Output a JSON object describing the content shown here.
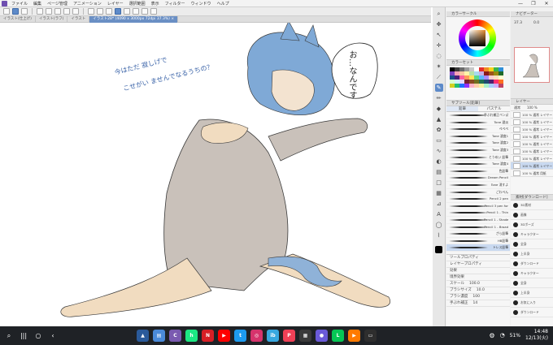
{
  "menu": {
    "items": [
      "ファイル",
      "編集",
      "ページ管理",
      "アニメーション",
      "レイヤー",
      "選択範囲",
      "表示",
      "フィルター",
      "ウィンドウ",
      "ヘルプ"
    ],
    "window_controls": [
      "—",
      "❐",
      "✕"
    ]
  },
  "tabs": [
    {
      "label": "イラスト(仕上げ) ",
      "active": false
    },
    {
      "label": "イラスト(ラフ)",
      "active": false
    },
    {
      "label": "イラスト",
      "active": false
    },
    {
      "label": "イラスト28* (4090 x 3000px 72dpi 37.3%) ×",
      "active": true
    }
  ],
  "canvas": {
    "handwritten_note_line1": "今はただ 寂しげで",
    "handwritten_note_line2": "こせがい ませんでなるうちの？",
    "speech_bubble": "お…なんです"
  },
  "color_panel": {
    "title": "カラーサークル",
    "palette_title": "カラーセット",
    "swatches": [
      "#000000",
      "#3a3a3a",
      "#6b6b6b",
      "#9a9a9a",
      "#c8c8c8",
      "#ffffff",
      "#e52e2e",
      "#f08a24",
      "#f7d21e",
      "#3bb44a",
      "#2f8fd8",
      "#7a3fbf",
      "#f4a3b5",
      "#f9c8a0",
      "#fff4a8",
      "#b6e3a8",
      "#a8d8f0",
      "#c8b0e8",
      "#8b1a1a",
      "#a0551a",
      "#9a8a10",
      "#1f6a2a",
      "#1a4f8a",
      "#4a1f7a",
      "#ff5fa0",
      "#ff9a5a",
      "#ffe55a",
      "#5ad88a",
      "#5ab8ff",
      "#a88aff",
      "#ffd0d0",
      "#ffe0c0",
      "#ffffd0",
      "#d8ffd0",
      "#d0f0ff",
      "#e8d8ff",
      "#7a2030",
      "#8a4a20",
      "#707020",
      "#207050",
      "#204a70",
      "#502070",
      "#ff3070",
      "#ff7020",
      "#d0d020",
      "#20c070",
      "#2070ff",
      "#9030ff",
      "#ffb0c8",
      "#ffd0a8",
      "#f8f0a0",
      "#a8f0c8",
      "#a8d0ff",
      "#d0b0ff",
      "#c04060"
    ]
  },
  "brush_panel": {
    "title": "サブツール[鉛筆]",
    "tab_left": "鉛筆",
    "tab_right": "パステル",
    "brushes": [
      "手ぶれ補正ペン(改)",
      "Tone 濃淡",
      "ぺぺぺ",
      "Tone 濃度1",
      "Tone 濃度2",
      "Tone 濃度3",
      "とうめい 鉛筆",
      "Tone 濃度4",
      "色鉛筆",
      "Dream Pencil",
      "Tone 消すよ",
      "ごわぺん",
      "Pencil 2 pen",
      "Pencil 3 pen for",
      "Pencil 1 - Thin",
      "Pencil 1 - Shaded",
      "Pencil 1 - Broad",
      "ざら鉛筆",
      "HB鉛筆",
      "トレス鉛筆"
    ],
    "selected_index": 19
  },
  "sub_panel": {
    "rows": [
      "ツールプロパティ",
      "レイヤープロパティ",
      "効果",
      "境界効果",
      "スケール",
      "ブラシサイズ",
      "ブラシ濃度",
      "手ぶれ補正"
    ],
    "values": [
      "",
      "",
      "",
      "",
      "100.0",
      "10.0",
      "100",
      "14"
    ]
  },
  "navigator": {
    "title": "ナビゲーター",
    "zoom": "37.3",
    "angle": "0.0"
  },
  "layer_panel": {
    "title": "レイヤー",
    "blend": "通常",
    "opacity": "100 %",
    "layers": [
      {
        "name": "100 % 通常 レイヤー 1",
        "sel": false
      },
      {
        "name": "100 % 通常 レイヤー 2",
        "sel": false
      },
      {
        "name": "100 % 通常 レイヤー 3",
        "sel": false
      },
      {
        "name": "100 % 通常 レイヤー 4",
        "sel": false
      },
      {
        "name": "100 % 通常 レイヤー 5",
        "sel": false
      },
      {
        "name": "100 % 通常 レイヤー 6",
        "sel": false
      },
      {
        "name": "100 % 通常 レイヤー 7",
        "sel": false
      },
      {
        "name": "100 % 通常 レイヤー",
        "sel": true
      },
      {
        "name": "100 % 通常 用紙",
        "sel": false
      }
    ]
  },
  "material_panel": {
    "title": "素材[ダウンロード]",
    "items": [
      "3D素材",
      "画像",
      "3Dポーズ",
      "キャラクター",
      "全身",
      "上半身",
      "ダウンロード",
      "キャラクター",
      "全身",
      "上半身",
      "お気に入り",
      "ダウンロード"
    ]
  },
  "taskbar": {
    "apps": [
      {
        "name": "gallery",
        "color": "#2a5a9a",
        "glyph": "▲"
      },
      {
        "name": "calendar",
        "color": "#4a8ad8",
        "glyph": "▤"
      },
      {
        "name": "clip",
        "color": "#7a5ab0",
        "glyph": "C"
      },
      {
        "name": "hulu",
        "color": "#1ce783",
        "glyph": "h"
      },
      {
        "name": "netflix",
        "color": "#d81f26",
        "glyph": "N"
      },
      {
        "name": "youtube",
        "color": "#ff0000",
        "glyph": "▶"
      },
      {
        "name": "twitter",
        "color": "#1d9bf0",
        "glyph": "t"
      },
      {
        "name": "instagram",
        "color": "#d6336c",
        "glyph": "◎"
      },
      {
        "name": "ibis",
        "color": "#38a8e0",
        "glyph": "ib"
      },
      {
        "name": "pocket",
        "color": "#ef4056",
        "glyph": "P"
      },
      {
        "name": "grid-app",
        "color": "#3a3a3a",
        "glyph": "▦"
      },
      {
        "name": "mail",
        "color": "#6a5ad8",
        "glyph": "●"
      },
      {
        "name": "line",
        "color": "#06c755",
        "glyph": "L"
      },
      {
        "name": "store",
        "color": "#ff7a00",
        "glyph": "▶"
      },
      {
        "name": "desktop",
        "color": "#2e2e2e",
        "glyph": "▭"
      }
    ],
    "battery": "51%",
    "time": "14:48",
    "date": "12/13(火)"
  }
}
